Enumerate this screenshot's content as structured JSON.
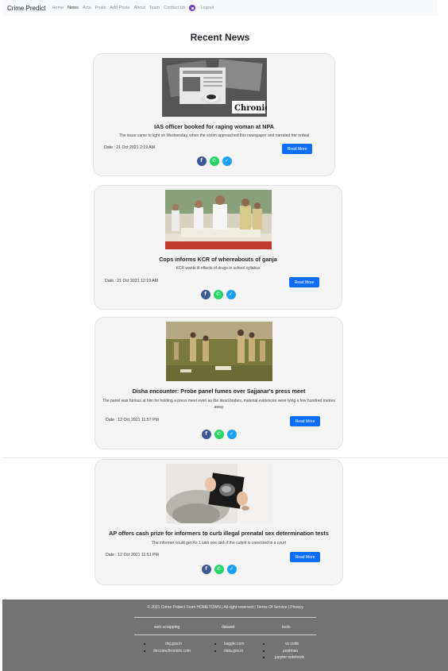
{
  "navbar": {
    "brand": "Crime Predict",
    "links": [
      "Home",
      "News",
      "Acts",
      "Posts",
      "Add Posts",
      "About",
      "Team",
      "Contact Us"
    ],
    "active": "News",
    "logout": "Logout"
  },
  "page_title": "Recent News",
  "news": [
    {
      "title": "IAS officer booked for raping woman at NPA",
      "description": "The issue came to light on Wednesday, when the victim approached this newspaper and narrated her ordeal",
      "date": "Date : 21 Oct 2021 2:19 AM",
      "read_more": "Read More",
      "image_text": "Chronicle"
    },
    {
      "title": "Cops informs KCR of whereabouts of ganja",
      "description": "KCR wants ill-effects of drugs in school syllabus",
      "date": "Date : 21 Oct 2021 12:19 AM",
      "read_more": "Read More"
    },
    {
      "title": "Disha encounter: Probe panel fumes over Sajjanar's press meet",
      "description": "The panel was furious at him for holding a press meet even as the dead bodies, material evidences were lying a few hundred metres away",
      "date": "Date : 12 Oct 2021 11:57 PM",
      "read_more": "Read More"
    },
    {
      "title": "AP offers cash prize for informers to curb illegal prenatal sex determination tests",
      "description": "The informer could get Rs 1 lakh one lakh if the culprit is convicted in a court",
      "date": "Date : 12 Oct 2021 11:51 PM",
      "read_more": "Read More"
    }
  ],
  "social_icons": [
    "facebook-icon",
    "whatsapp-icon",
    "twitter-icon"
  ],
  "footer": {
    "copyright": "© 2021 Crime Pridect From HOMETOWN | All right reserved | Terms Of Service | Privacy",
    "columns": [
      {
        "heading": "web scrapping",
        "items": [
          "dnj.gov.in",
          "deccanchronicle.com"
        ]
      },
      {
        "heading": "dataset",
        "items": [
          "kaggle.com",
          "data.gov.in"
        ]
      },
      {
        "heading": "tools",
        "items": [
          "vs code",
          "postman",
          "jupyter notebook"
        ]
      }
    ]
  },
  "colors": {
    "primary": "#0d6efd",
    "facebook": "#3b5998",
    "whatsapp": "#25d366",
    "twitter": "#1da1f2",
    "footer_bg": "#737373",
    "card_bg": "#f5f5f5"
  }
}
